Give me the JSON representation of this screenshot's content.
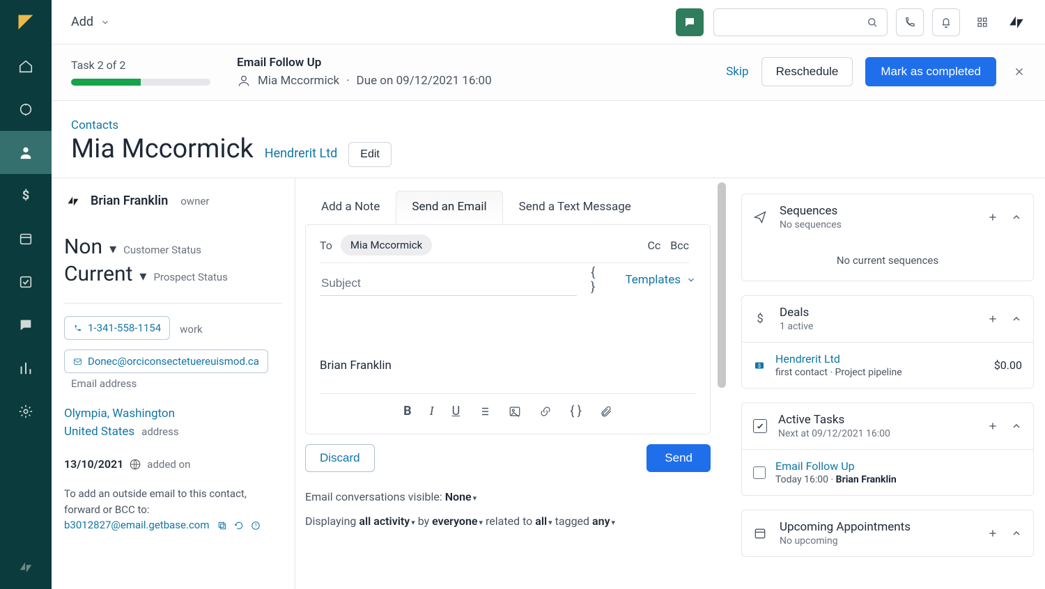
{
  "topbar": {
    "add_label": "Add"
  },
  "task": {
    "progress_label": "Task 2 of 2",
    "title": "Email Follow Up",
    "person": "Mia Mccormick",
    "due": "Due on 09/12/2021 16:00",
    "skip": "Skip",
    "reschedule": "Reschedule",
    "complete": "Mark as completed"
  },
  "header": {
    "breadcrumb": "Contacts",
    "name": "Mia Mccormick",
    "company": "Hendrerit Ltd",
    "edit": "Edit"
  },
  "owner": {
    "name": "Brian Franklin",
    "role": "owner"
  },
  "status": {
    "customer_val": "Non",
    "customer_lbl": "Customer Status",
    "prospect_val": "Current",
    "prospect_lbl": "Prospect Status"
  },
  "contact": {
    "phone": "1-341-558-1154",
    "phone_lbl": "work",
    "email": "Donec@orciconsectetuereuismod.ca",
    "email_lbl": "Email address",
    "loc_city": "Olympia, Washington",
    "loc_country": "United States",
    "loc_lbl": "address",
    "added_date": "13/10/2021",
    "added_lbl": "added on",
    "note": "To add an outside email to this contact, forward or BCC to: ",
    "note_email": "b3012827@email.getbase.com"
  },
  "tabs": {
    "note": "Add a Note",
    "email": "Send an Email",
    "sms": "Send a Text Message"
  },
  "composer": {
    "to_lbl": "To",
    "to_chip": "Mia Mccormick",
    "cc": "Cc",
    "bcc": "Bcc",
    "subject_placeholder": "Subject",
    "templates": "Templates",
    "signature": "Brian Franklin",
    "discard": "Discard",
    "send": "Send"
  },
  "filters": {
    "visible_lbl": "Email conversations visible:",
    "visible_val": "None",
    "displaying": "Displaying",
    "activity": "all activity",
    "by": "by",
    "who": "everyone",
    "related": "related to",
    "rel_val": "all",
    "tagged": "tagged",
    "tag_val": "any"
  },
  "cards": {
    "sequences": {
      "title": "Sequences",
      "sub": "No sequences",
      "empty": "No current sequences"
    },
    "deals": {
      "title": "Deals",
      "sub": "1 active",
      "deal_name": "Hendrerit Ltd",
      "deal_sub": "first contact · Project pipeline",
      "deal_amt": "$0.00"
    },
    "tasks": {
      "title": "Active Tasks",
      "sub": "Next at 09/12/2021 16:00",
      "task_name": "Email Follow Up",
      "task_sub_time": "Today 16:00 · ",
      "task_sub_who": "Brian Franklin"
    },
    "appts": {
      "title": "Upcoming Appointments",
      "sub": "No upcoming"
    }
  }
}
